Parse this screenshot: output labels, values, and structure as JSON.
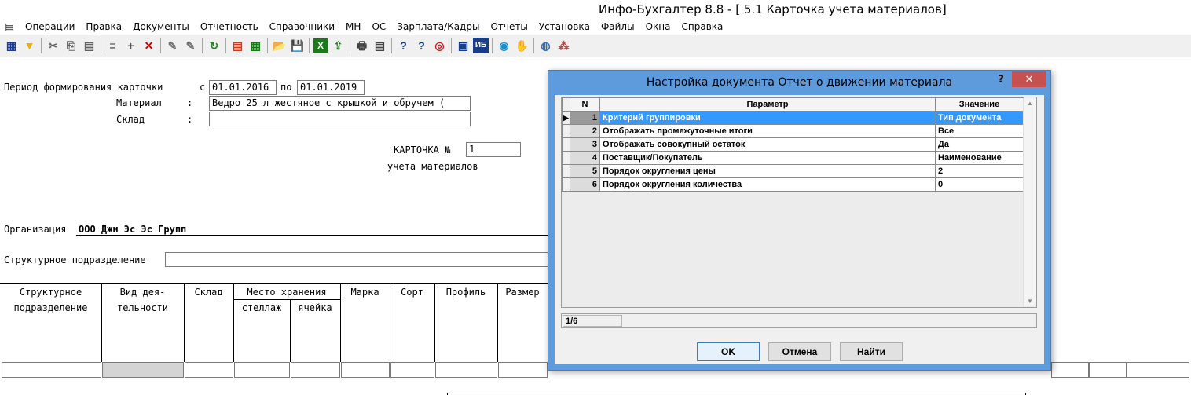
{
  "window": {
    "title": "Инфо-Бухгалтер 8.8 - [ 5.1 Карточка учета материалов]"
  },
  "menu": [
    "Операции",
    "Правка",
    "Документы",
    "Отчетность",
    "Справочники",
    "МН",
    "ОС",
    "Зарплата/Кадры",
    "Отчеты",
    "Установка",
    "Файлы",
    "Окна",
    "Справка"
  ],
  "toolbar": {
    "icons": [
      "table-icon",
      "filter-icon",
      "cut-icon",
      "copy-icon",
      "paste-icon",
      "numbering-icon",
      "add-icon",
      "delete-icon",
      "pin-icon",
      "pin-text-icon",
      "refresh-icon",
      "calendar-icon",
      "calculator-icon",
      "open-folder-icon",
      "save-icon",
      "excel-icon",
      "export-icon",
      "print-icon",
      "print-preview-icon",
      "help-icon",
      "whats-this-icon",
      "compass-icon",
      "book-icon",
      "ib10-icon",
      "support-icon",
      "hand-icon",
      "globe-icon",
      "network-icon"
    ],
    "glyphs": [
      "▦",
      "▼",
      "✂",
      "⎘",
      "▤",
      "≡",
      "+",
      "✕",
      "✎",
      "✎",
      "↻",
      "▤",
      "▦",
      "📂",
      "💾",
      "X",
      "⇪",
      "🖶",
      "▤",
      "?",
      "?",
      "◎",
      "▣",
      "ИБ",
      "◉",
      "✋",
      "◍",
      "⁂"
    ],
    "colors": [
      "#1f3d8a",
      "#e8b000",
      "#606060",
      "#606060",
      "#606060",
      "#333333",
      "#555555",
      "#cc0000",
      "#707070",
      "#707070",
      "#1a8c1a",
      "#c04020",
      "#1a7a1a",
      "#d09000",
      "#1a3d8a",
      "#1a7a1a",
      "#1a7a1a",
      "#444444",
      "#444444",
      "#1a3d8a",
      "#1a3d8a",
      "#cc2020",
      "#1a3d8a",
      "#1a3d8a",
      "#1a8cc8",
      "#c04040",
      "#3070c0",
      "#c04040"
    ]
  },
  "card": {
    "period_label": "Период формирования карточки",
    "from_label": "с",
    "from_value": "01.01.2016",
    "to_label": "по",
    "to_value": "01.01.2019",
    "material_label": "Материал",
    "colon": ":",
    "material_value": "Ведро 25 л жестяное с крышкой и обручем (",
    "warehouse_label": "Склад",
    "warehouse_value": "",
    "card_no_label": "КАРТОЧКА №",
    "card_no_value": "1",
    "card_subtitle": "учета материалов",
    "org_label": "Организация",
    "org_value": "ООО Джи Эс Эс Групп",
    "division_label": "Структурное подразделение",
    "division_value": ""
  },
  "table": {
    "col_division_1": "Структурное",
    "col_division_2": "подразделение",
    "col_activity_1": "Вид дея-",
    "col_activity_2": "тельности",
    "col_warehouse": "Склад",
    "col_storage": "Место хранения",
    "col_rack": "стеллаж",
    "col_cell": "ячейка",
    "col_brand": "Марка",
    "col_grade": "Сорт",
    "col_profile": "Профиль",
    "col_size": "Размер"
  },
  "dialog": {
    "title": "Настройка документа Отчет о движении материала",
    "help": "?",
    "close": "✕",
    "headers": {
      "n": "N",
      "param": "Параметр",
      "value": "Значение"
    },
    "rows": [
      {
        "n": "1",
        "param": "Критерий группировки",
        "value": "Тип документа",
        "selected": true
      },
      {
        "n": "2",
        "param": "Отображать промежуточные итоги",
        "value": "Все"
      },
      {
        "n": "3",
        "param": "Отображать совокупный остаток",
        "value": "Да"
      },
      {
        "n": "4",
        "param": "Поставщик/Покупатель",
        "value": "Наименование"
      },
      {
        "n": "5",
        "param": "Порядок округления цены",
        "value": "2"
      },
      {
        "n": "6",
        "param": "Порядок округления количества",
        "value": "0"
      }
    ],
    "status": "1/6",
    "ok_label": "OK",
    "cancel_label": "Отмена",
    "find_label": "Найти"
  }
}
